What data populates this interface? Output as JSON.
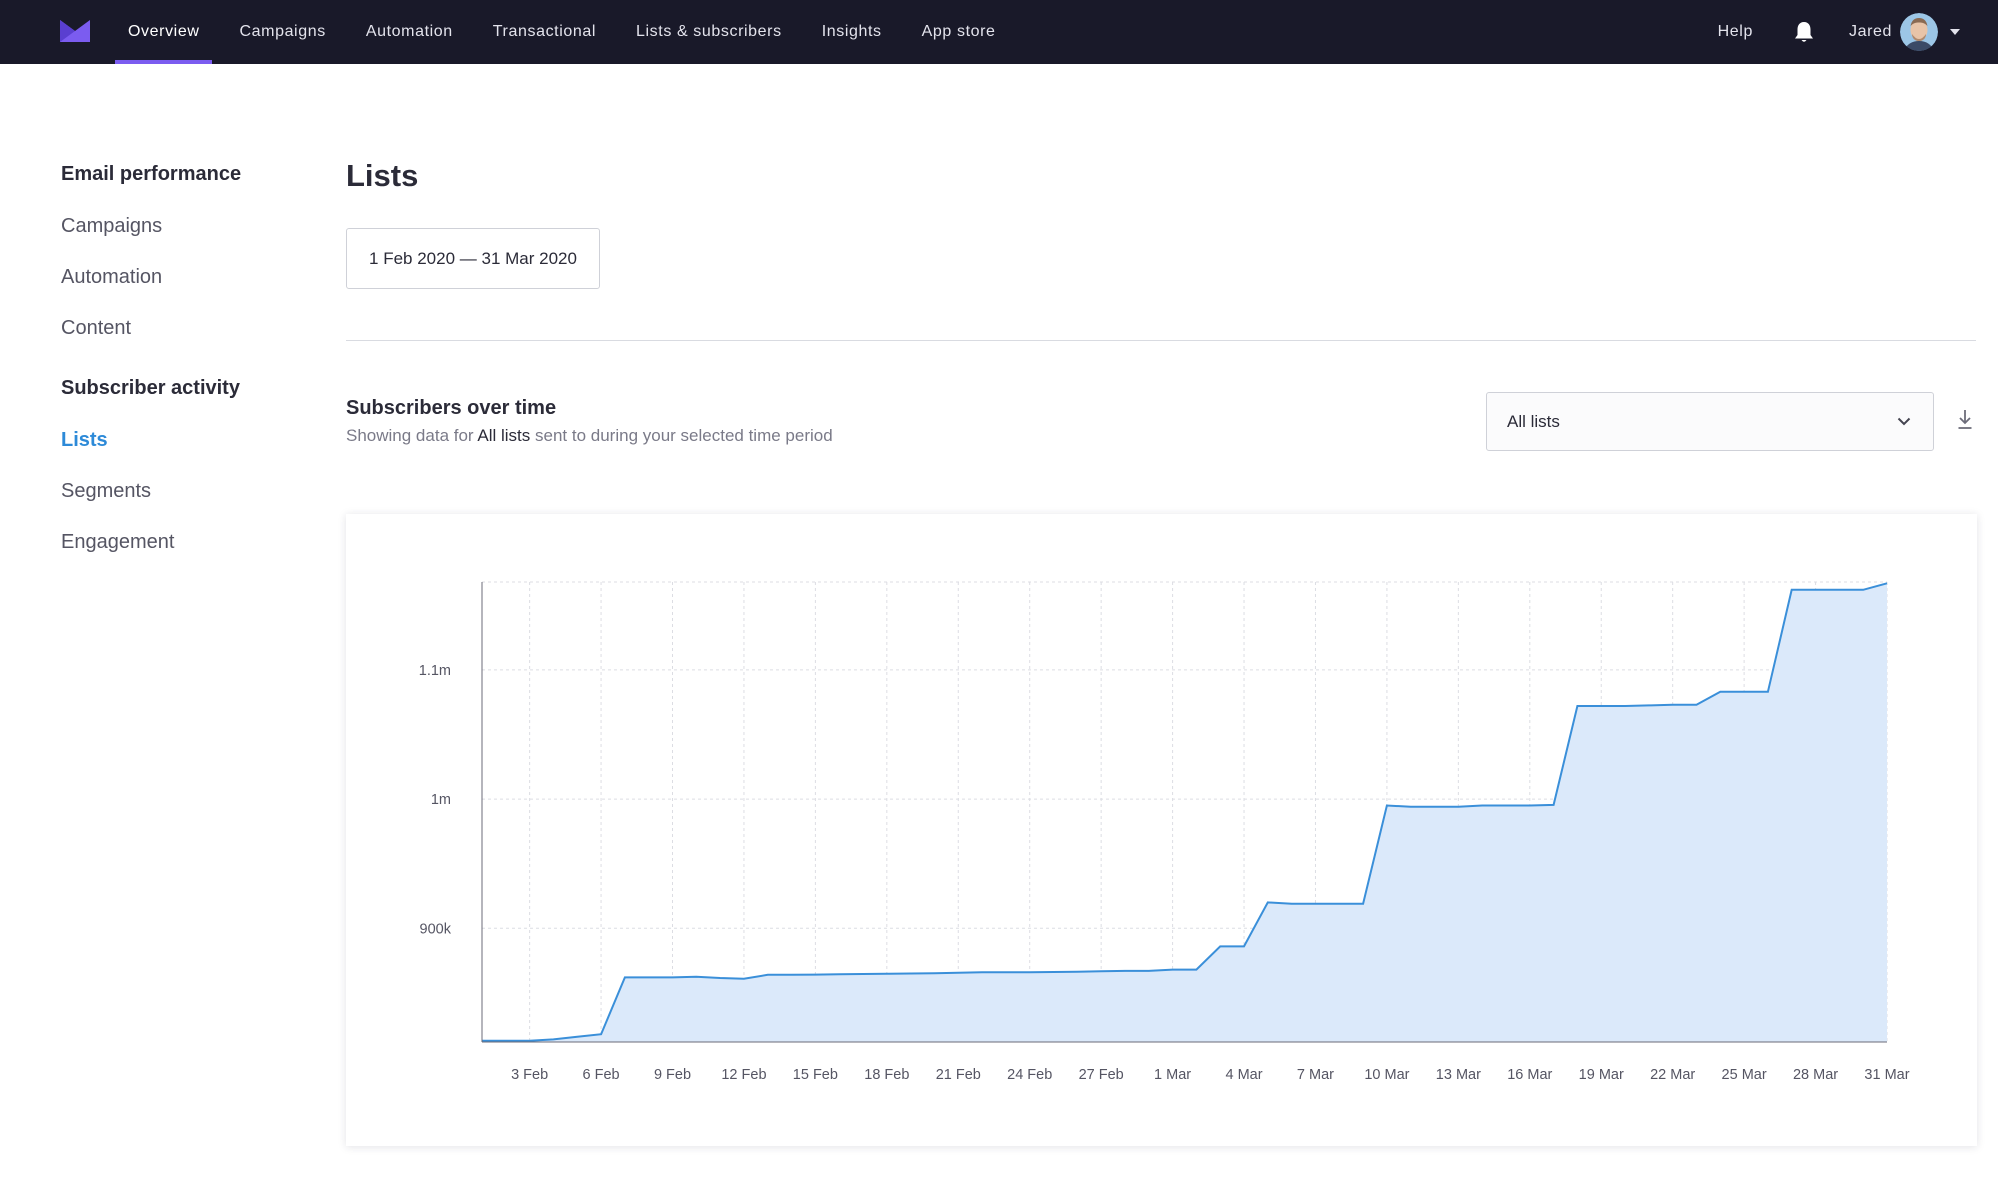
{
  "nav": {
    "items": [
      {
        "label": "Overview",
        "active": true
      },
      {
        "label": "Campaigns",
        "active": false
      },
      {
        "label": "Automation",
        "active": false
      },
      {
        "label": "Transactional",
        "active": false
      },
      {
        "label": "Lists & subscribers",
        "active": false
      },
      {
        "label": "Insights",
        "active": false
      },
      {
        "label": "App store",
        "active": false
      }
    ],
    "help": "Help",
    "user": "Jared",
    "icons": {
      "logo": "envelope-logo-icon",
      "bell": "bell-icon",
      "caret": "caret-down-icon"
    }
  },
  "sidebar": {
    "sections": [
      {
        "heading": "Email performance",
        "items": [
          {
            "label": "Campaigns",
            "active": false
          },
          {
            "label": "Automation",
            "active": false
          },
          {
            "label": "Content",
            "active": false
          }
        ]
      },
      {
        "heading": "Subscriber activity",
        "items": [
          {
            "label": "Lists",
            "active": true
          },
          {
            "label": "Segments",
            "active": false
          },
          {
            "label": "Engagement",
            "active": false
          }
        ]
      }
    ]
  },
  "main": {
    "title": "Lists",
    "date_range": "1 Feb 2020 — 31 Mar 2020",
    "section_title": "Subscribers over time",
    "subtitle_before": "Showing data for ",
    "subtitle_highlight": "All lists",
    "subtitle_after": " sent to during your selected time period",
    "list_select": "All lists"
  },
  "colors": {
    "nav_bg": "#191929",
    "accent": "#7b5cf0",
    "link": "#2d8ad8",
    "line": "#3a8fd9",
    "fill": "#dbe9fa"
  },
  "chart_data": {
    "type": "area",
    "title": "",
    "xlabel": "",
    "ylabel": "",
    "x_ticks": [
      "3 Feb",
      "6 Feb",
      "9 Feb",
      "12 Feb",
      "15 Feb",
      "18 Feb",
      "21 Feb",
      "24 Feb",
      "27 Feb",
      "1 Mar",
      "4 Mar",
      "7 Mar",
      "10 Mar",
      "13 Mar",
      "16 Mar",
      "19 Mar",
      "22 Mar",
      "25 Mar",
      "28 Mar",
      "31 Mar"
    ],
    "y_ticks": [
      {
        "value": 900000,
        "label": "900k"
      },
      {
        "value": 1000000,
        "label": "1m"
      },
      {
        "value": 1100000,
        "label": "1.1m"
      }
    ],
    "ylim": [
      812000,
      1168000
    ],
    "grid": true,
    "series": [
      {
        "x": [
          "1 Feb",
          "2 Feb",
          "3 Feb",
          "4 Feb",
          "5 Feb",
          "6 Feb",
          "7 Feb",
          "8 Feb",
          "9 Feb",
          "10 Feb",
          "11 Feb",
          "12 Feb",
          "13 Feb",
          "14 Feb",
          "15 Feb",
          "16 Feb",
          "17 Feb",
          "18 Feb",
          "19 Feb",
          "20 Feb",
          "21 Feb",
          "22 Feb",
          "23 Feb",
          "24 Feb",
          "25 Feb",
          "26 Feb",
          "27 Feb",
          "28 Feb",
          "29 Feb",
          "1 Mar",
          "2 Mar",
          "3 Mar",
          "4 Mar",
          "5 Mar",
          "6 Mar",
          "7 Mar",
          "8 Mar",
          "9 Mar",
          "10 Mar",
          "11 Mar",
          "12 Mar",
          "13 Mar",
          "14 Mar",
          "15 Mar",
          "16 Mar",
          "17 Mar",
          "18 Mar",
          "19 Mar",
          "20 Mar",
          "21 Mar",
          "22 Mar",
          "23 Mar",
          "24 Mar",
          "25 Mar",
          "26 Mar",
          "27 Mar",
          "28 Mar",
          "29 Mar",
          "30 Mar",
          "31 Mar"
        ],
        "values": [
          813000,
          813000,
          813000,
          814000,
          816000,
          818000,
          862000,
          862000,
          862000,
          862500,
          861500,
          861000,
          864000,
          864000,
          864200,
          864500,
          864600,
          864800,
          865000,
          865200,
          865600,
          866000,
          866000,
          866000,
          866200,
          866400,
          866800,
          867000,
          867000,
          868000,
          868000,
          886000,
          886000,
          920000,
          919000,
          919000,
          919000,
          919000,
          995000,
          994000,
          994000,
          994000,
          995000,
          995000,
          995000,
          995500,
          1072000,
          1072000,
          1072000,
          1072500,
          1073000,
          1073000,
          1083000,
          1083000,
          1083000,
          1162000,
          1162000,
          1162000,
          1162000,
          1167000
        ]
      }
    ]
  }
}
